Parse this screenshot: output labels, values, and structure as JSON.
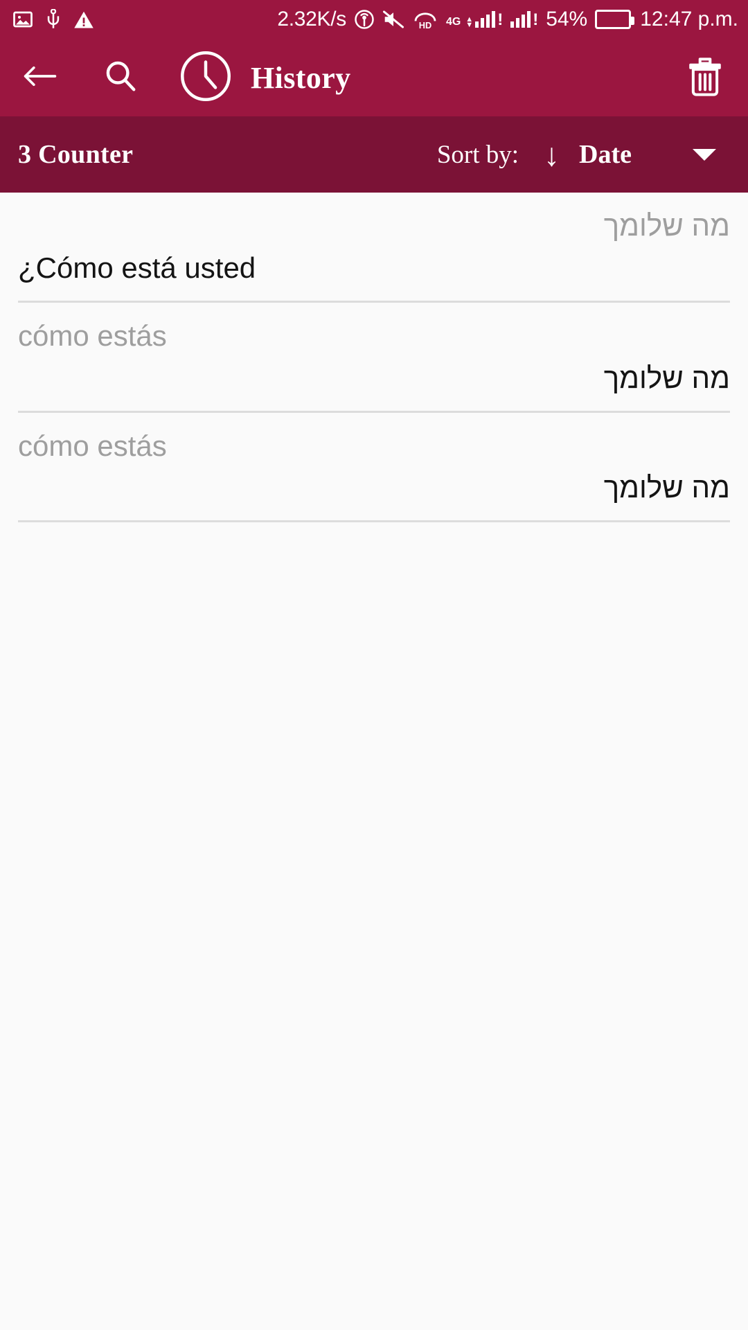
{
  "status_bar": {
    "icons_left": [
      "image-icon",
      "usb-icon",
      "warning-icon"
    ],
    "network_speed": "2.32K/s",
    "hotspot_icon": "hotspot-icon",
    "mute_icon": "mute-icon",
    "hd_label": "HD",
    "network_type": "4G",
    "signal_alert": "!",
    "battery_percent": "54%",
    "battery_color": "#19E019",
    "clock": "12:47 p.m."
  },
  "app_bar": {
    "back_icon": "back-arrow-icon",
    "search_icon": "search-icon",
    "clock_icon": "clock-icon",
    "title": "History",
    "delete_icon": "trash-icon",
    "background_color": "#9B1640"
  },
  "sort_bar": {
    "counter": "3 Counter",
    "sort_by_label": "Sort by:",
    "sort_direction_icon": "arrow-down-icon",
    "sort_value": "Date",
    "dropdown_icon": "caret-down-icon",
    "background_color": "#7B1236"
  },
  "history": {
    "items": [
      {
        "source": "מה שלומך",
        "source_dir": "rtl",
        "target": "¿Cómo está usted",
        "target_dir": "ltr"
      },
      {
        "source": "cómo estás",
        "source_dir": "ltr",
        "target": "מה שלומך",
        "target_dir": "rtl"
      },
      {
        "source": "cómo estás",
        "source_dir": "ltr",
        "target": "מה שלומך",
        "target_dir": "rtl"
      }
    ]
  }
}
